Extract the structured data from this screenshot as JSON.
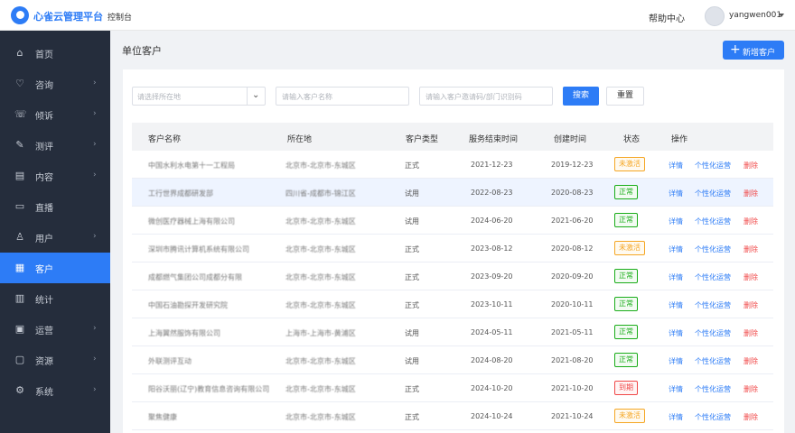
{
  "header": {
    "brand": "心雀云管理平台",
    "console": "控制台",
    "help": "帮助中心",
    "username": "yangwen001"
  },
  "sidebar": {
    "items": [
      {
        "label": "首页",
        "icon": "home-icon",
        "arrow": false,
        "active": false
      },
      {
        "label": "咨询",
        "icon": "heart-chat-icon",
        "arrow": true,
        "active": false
      },
      {
        "label": "倾诉",
        "icon": "phone-icon",
        "arrow": true,
        "active": false
      },
      {
        "label": "测评",
        "icon": "edit-icon",
        "arrow": true,
        "active": false
      },
      {
        "label": "内容",
        "icon": "document-icon",
        "arrow": true,
        "active": false
      },
      {
        "label": "直播",
        "icon": "video-icon",
        "arrow": false,
        "active": false
      },
      {
        "label": "用户",
        "icon": "user-icon",
        "arrow": true,
        "active": false
      },
      {
        "label": "客户",
        "icon": "customer-icon",
        "arrow": false,
        "active": true
      },
      {
        "label": "统计",
        "icon": "bar-chart-icon",
        "arrow": false,
        "active": false
      },
      {
        "label": "运营",
        "icon": "monitor-icon",
        "arrow": true,
        "active": false
      },
      {
        "label": "资源",
        "icon": "folder-icon",
        "arrow": true,
        "active": false
      },
      {
        "label": "系统",
        "icon": "settings-icon",
        "arrow": true,
        "active": false
      }
    ]
  },
  "page": {
    "title": "单位客户",
    "add_button": "新增客户"
  },
  "filters": {
    "region_placeholder": "请选择所在地",
    "name_placeholder": "请输入客户名称",
    "code_placeholder": "请输入客户邀请码/部门识别码",
    "search": "搜索",
    "reset": "重置"
  },
  "table": {
    "columns": [
      "客户名称",
      "所在地",
      "客户类型",
      "服务结束时间",
      "创建时间",
      "状态",
      "操作"
    ],
    "actions": {
      "detail": "详情",
      "ops": "个性化运营",
      "delete": "删除"
    },
    "rows": [
      {
        "name": "中国水利水电第十一工程局",
        "location": "北京市-北京市-东城区",
        "type": "正式",
        "end": "2021-12-23",
        "created": "2019-12-23",
        "status": "未激活",
        "status_kind": "inactive"
      },
      {
        "name": "工行世界成都研发部",
        "location": "四川省-成都市-锦江区",
        "type": "试用",
        "end": "2022-08-23",
        "created": "2020-08-23",
        "status": "正常",
        "status_kind": "normal"
      },
      {
        "name": "微创医疗器械上海有限公司",
        "location": "北京市-北京市-东城区",
        "type": "试用",
        "end": "2024-06-20",
        "created": "2021-06-20",
        "status": "正常",
        "status_kind": "normal"
      },
      {
        "name": "深圳市腾讯计算机系统有限公司",
        "location": "北京市-北京市-东城区",
        "type": "正式",
        "end": "2023-08-12",
        "created": "2020-08-12",
        "status": "未激活",
        "status_kind": "inactive"
      },
      {
        "name": "成都燃气集团公司成都分有限",
        "location": "北京市-北京市-东城区",
        "type": "正式",
        "end": "2023-09-20",
        "created": "2020-09-20",
        "status": "正常",
        "status_kind": "normal"
      },
      {
        "name": "中国石油勘探开发研究院",
        "location": "北京市-北京市-东城区",
        "type": "正式",
        "end": "2023-10-11",
        "created": "2020-10-11",
        "status": "正常",
        "status_kind": "normal"
      },
      {
        "name": "上海翼然服饰有限公司",
        "location": "上海市-上海市-黄浦区",
        "type": "试用",
        "end": "2024-05-11",
        "created": "2021-05-11",
        "status": "正常",
        "status_kind": "normal"
      },
      {
        "name": "外联测评互动",
        "location": "北京市-北京市-东城区",
        "type": "试用",
        "end": "2024-08-20",
        "created": "2021-08-20",
        "status": "正常",
        "status_kind": "normal"
      },
      {
        "name": "阳谷沃丽(辽宁)教育信息咨询有限公司",
        "location": "北京市-北京市-东城区",
        "type": "正式",
        "end": "2024-10-20",
        "created": "2021-10-20",
        "status": "到期",
        "status_kind": "expired"
      },
      {
        "name": "聚焦健康",
        "location": "北京市-北京市-东城区",
        "type": "正式",
        "end": "2024-10-24",
        "created": "2021-10-24",
        "status": "未激活",
        "status_kind": "inactive"
      }
    ]
  }
}
